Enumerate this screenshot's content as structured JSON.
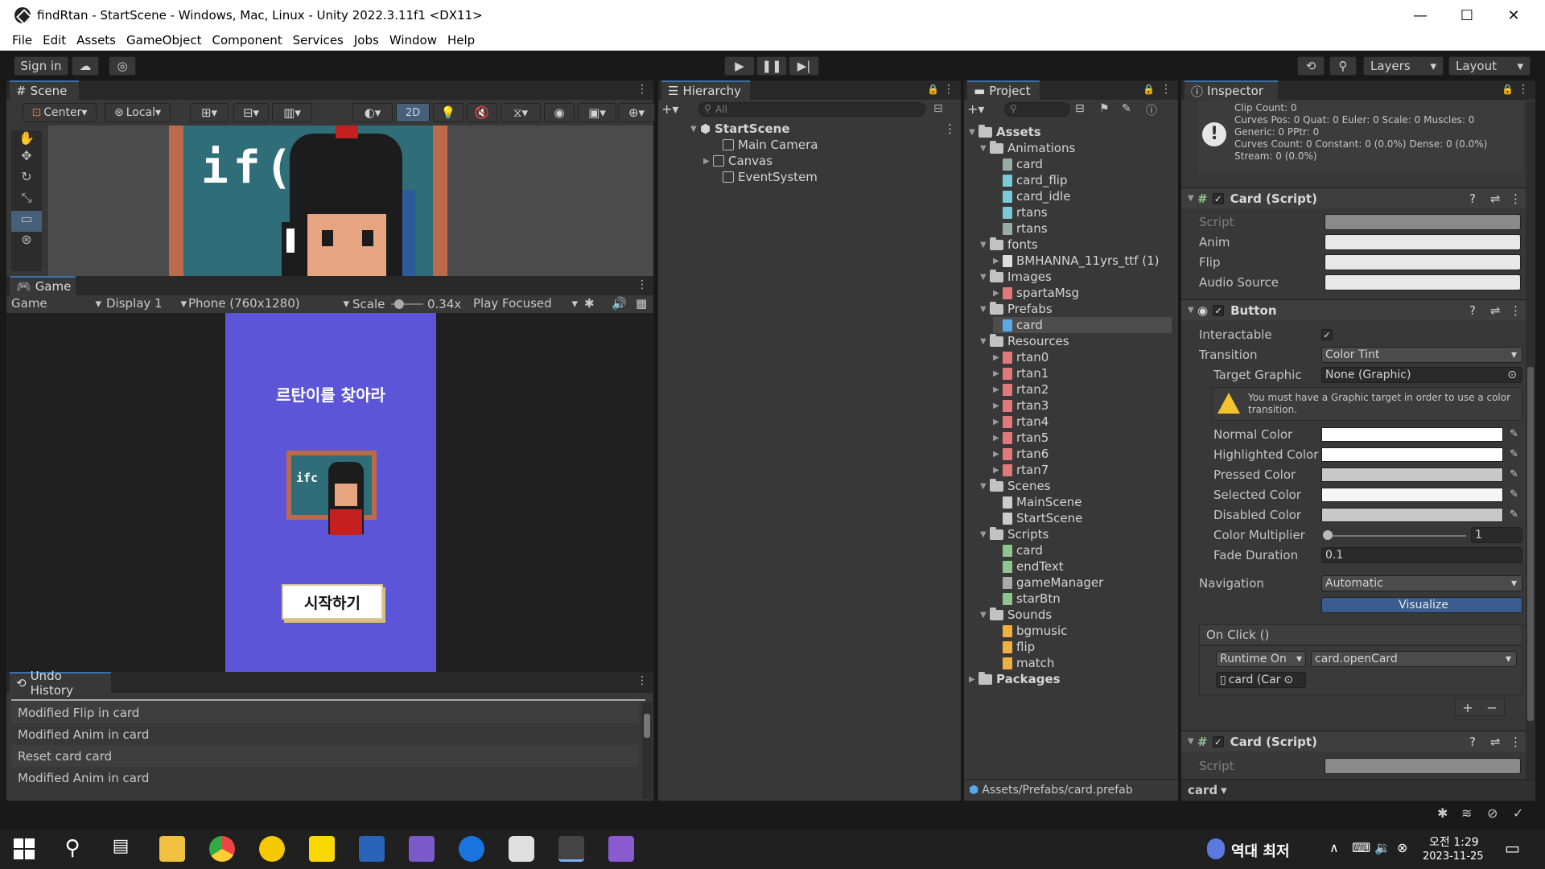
{
  "window": {
    "title": "findRtan - StartScene - Windows, Mac, Linux - Unity 2022.3.11f1 <DX11>",
    "minimize": "—",
    "maximize": "☐",
    "close": "✕"
  },
  "menu": [
    "File",
    "Edit",
    "Assets",
    "GameObject",
    "Component",
    "Services",
    "Jobs",
    "Window",
    "Help"
  ],
  "toolbar": {
    "sign_in": "Sign in",
    "layers": "Layers",
    "layout": "Layout"
  },
  "scene": {
    "tab": "Scene",
    "pivot": "Center",
    "space": "Local",
    "mode2d": "2D",
    "board_text": "if("
  },
  "game": {
    "tab": "Game",
    "view": "Game",
    "display": "Display 1",
    "resolution": "Phone (760x1280)",
    "scale_label": "Scale",
    "scale_value": "0.34x",
    "play_mode": "Play Focused",
    "heading": "르탄이를 찾아라",
    "board_text": "ifc",
    "start_button": "시작하기"
  },
  "undo": {
    "tab": "Undo History",
    "items": [
      "Modified Flip in card",
      "Modified Anim in card",
      "Reset card card",
      "Modified Anim in card"
    ]
  },
  "hierarchy": {
    "tab": "Hierarchy",
    "search_placeholder": "All",
    "scene": "StartScene",
    "objects": [
      "Main Camera",
      "Canvas",
      "EventSystem"
    ]
  },
  "project": {
    "tab": "Project",
    "root": "Assets",
    "tree": [
      {
        "label": "Animations",
        "type": "folder",
        "depth": 1
      },
      {
        "label": "card",
        "type": "anim",
        "depth": 2
      },
      {
        "label": "card_flip",
        "type": "clip",
        "depth": 2
      },
      {
        "label": "card_idle",
        "type": "clip",
        "depth": 2
      },
      {
        "label": "rtans",
        "type": "clip",
        "depth": 2
      },
      {
        "label": "rtans",
        "type": "anim",
        "depth": 2
      },
      {
        "label": "fonts",
        "type": "folder",
        "depth": 1
      },
      {
        "label": "BMHANNA_11yrs_ttf (1)",
        "type": "font",
        "depth": 2
      },
      {
        "label": "Images",
        "type": "folder",
        "depth": 1
      },
      {
        "label": "spartaMsg",
        "type": "sprite",
        "depth": 2
      },
      {
        "label": "Prefabs",
        "type": "folder",
        "depth": 1
      },
      {
        "label": "card",
        "type": "prefab",
        "depth": 2
      },
      {
        "label": "Resources",
        "type": "folder",
        "depth": 1
      },
      {
        "label": "rtan0",
        "type": "sprite",
        "depth": 2
      },
      {
        "label": "rtan1",
        "type": "sprite",
        "depth": 2
      },
      {
        "label": "rtan2",
        "type": "sprite",
        "depth": 2
      },
      {
        "label": "rtan3",
        "type": "sprite",
        "depth": 2
      },
      {
        "label": "rtan4",
        "type": "sprite",
        "depth": 2
      },
      {
        "label": "rtan5",
        "type": "sprite",
        "depth": 2
      },
      {
        "label": "rtan6",
        "type": "sprite",
        "depth": 2
      },
      {
        "label": "rtan7",
        "type": "sprite",
        "depth": 2
      },
      {
        "label": "Scenes",
        "type": "folder",
        "depth": 1
      },
      {
        "label": "MainScene",
        "type": "scene",
        "depth": 2
      },
      {
        "label": "StartScene",
        "type": "scene",
        "depth": 2
      },
      {
        "label": "Scripts",
        "type": "folder",
        "depth": 1
      },
      {
        "label": "card",
        "type": "script",
        "depth": 2
      },
      {
        "label": "endText",
        "type": "script",
        "depth": 2
      },
      {
        "label": "gameManager",
        "type": "gear",
        "depth": 2
      },
      {
        "label": "starBtn",
        "type": "script",
        "depth": 2
      },
      {
        "label": "Sounds",
        "type": "folder",
        "depth": 1
      },
      {
        "label": "bgmusic",
        "type": "audio",
        "depth": 2
      },
      {
        "label": "flip",
        "type": "audio",
        "depth": 2
      },
      {
        "label": "match",
        "type": "audio",
        "depth": 2
      },
      {
        "label": "Packages",
        "type": "folder",
        "depth": 0
      }
    ],
    "path": "Assets/Prefabs/card.prefab"
  },
  "inspector": {
    "tab": "Inspector",
    "anim_info": [
      "Clip Count: 0",
      "Curves Pos: 0 Quat: 0 Euler: 0 Scale: 0 Muscles: 0",
      "Generic: 0 PPtr: 0",
      "Curves Count: 0 Constant: 0 (0.0%) Dense: 0 (0.0%)",
      "Stream: 0 (0.0%)"
    ],
    "card_script": {
      "title": "Card (Script)",
      "fields": [
        "Script",
        "Anim",
        "Flip",
        "Audio Source"
      ]
    },
    "button": {
      "title": "Button",
      "interactable_label": "Interactable",
      "transition_label": "Transition",
      "transition_value": "Color Tint",
      "target_graphic_label": "Target Graphic",
      "target_graphic_value": "None (Graphic)",
      "warning": "You must have a Graphic target in order to use a color transition.",
      "colors": [
        "Normal Color",
        "Highlighted Color",
        "Pressed Color",
        "Selected Color",
        "Disabled Color"
      ],
      "multiplier_label": "Color Multiplier",
      "multiplier_value": "1",
      "fade_label": "Fade Duration",
      "fade_value": "0.1",
      "navigation_label": "Navigation",
      "navigation_value": "Automatic",
      "visualize": "Visualize",
      "onclick": "On Click ()",
      "runtime": "Runtime On",
      "method": "card.openCard",
      "object": "card (Car"
    },
    "card_script2": {
      "title": "Card (Script)",
      "script_label": "Script"
    },
    "footer_object": "card"
  },
  "taskbar": {
    "weather": "역대 최저",
    "time": "오전 1:29",
    "date": "2023-11-25"
  },
  "colors": {
    "game_bg": "#5d55d8",
    "accent": "#3a72b0",
    "visualize": "#3a5c8f"
  }
}
